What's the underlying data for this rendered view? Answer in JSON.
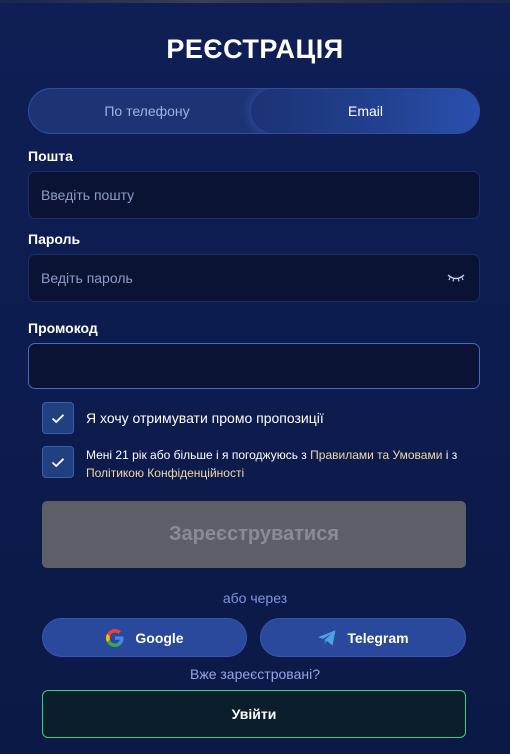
{
  "title": "РЕЄСТРАЦІЯ",
  "tabs": [
    {
      "label": "По телефону",
      "active": false
    },
    {
      "label": "Email",
      "active": true
    }
  ],
  "email": {
    "label": "Пошта",
    "placeholder": "Введіть пошту",
    "value": ""
  },
  "password": {
    "label": "Пароль",
    "placeholder": "Ведіть пароль",
    "value": "",
    "icon": "eye-closed-icon"
  },
  "promo": {
    "label": "Промокод",
    "placeholder": "",
    "value": ""
  },
  "checks": {
    "promo_offers": {
      "text": "Я хочу отримувати промо пропозиції",
      "checked": true
    },
    "terms": {
      "prefix": "Мені 21 рік або більше і я погоджуюсь з ",
      "terms_link": "Правилами та Умовами",
      "middle": " і з ",
      "privacy_link": "Політикою Конфіденційності",
      "checked": true
    }
  },
  "register_button": "Зареєструватися",
  "or_via": "або через",
  "social": {
    "google": {
      "label": "Google",
      "icon": "google-icon"
    },
    "telegram": {
      "label": "Telegram",
      "icon": "telegram-icon"
    }
  },
  "already_registered": "Вже зареєстровані?",
  "login_button": "Увійти",
  "colors": {
    "background": "#0b1946",
    "tab_active_glow": "#2a4fae",
    "link": "#f0d9a6",
    "disabled_button": "#5c5f66",
    "login_border": "#3ccf78"
  }
}
